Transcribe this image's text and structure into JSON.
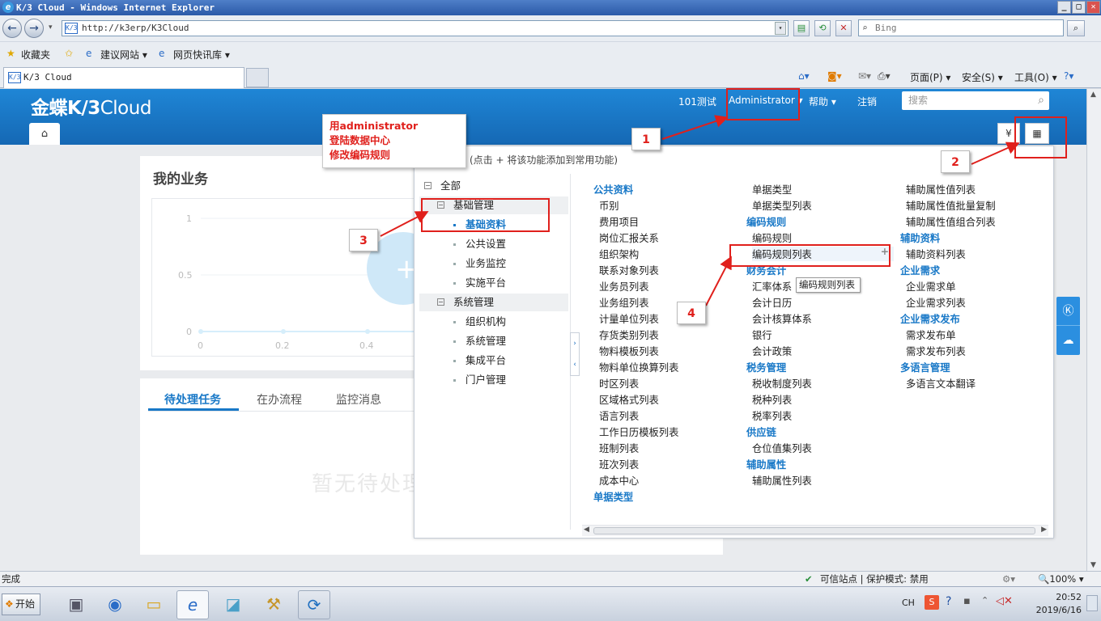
{
  "window": {
    "title": "K/3 Cloud - Windows Internet Explorer",
    "buttons": [
      "_",
      "□",
      "✕"
    ]
  },
  "browser": {
    "url": "http://k3erp/K3Cloud",
    "search_placeholder": "Bing",
    "favorites_label": "收藏夹",
    "fav_items": [
      "建议网站 ▾",
      "网页快讯库 ▾"
    ],
    "tab_title": "K/3 Cloud",
    "commands": [
      "页面(P) ▾",
      "安全(S) ▾",
      "工具(O) ▾"
    ]
  },
  "app": {
    "logo_main": "金蝶K/3",
    "logo_thin": "Cloud",
    "header_links": {
      "org": "101测试",
      "user": "Administrator ▾",
      "help": "帮助 ▾",
      "logout": "注销"
    },
    "search_placeholder": "搜索"
  },
  "dashboard": {
    "my_business": "我的业务",
    "chart_y_ticks": [
      "1",
      "0.5",
      "0"
    ],
    "chart_x_ticks": [
      "0",
      "0.2",
      "0.4"
    ],
    "tabs": [
      "待处理任务",
      "在办流程",
      "监控消息"
    ],
    "empty_text": "暂无待处理"
  },
  "panel": {
    "hint": "(点击 + 将该功能添加到常用功能)",
    "tree": {
      "root": "全部",
      "groups": [
        {
          "label": "基础管理",
          "children": [
            "基础资料",
            "公共设置",
            "业务监控",
            "实施平台"
          ]
        },
        {
          "label": "系统管理",
          "children": [
            "组织机构",
            "系统管理",
            "集成平台",
            "门户管理"
          ]
        }
      ]
    },
    "col1": [
      {
        "t": "公共资料",
        "h": true
      },
      {
        "t": "币别"
      },
      {
        "t": "费用项目"
      },
      {
        "t": "岗位汇报关系"
      },
      {
        "t": "组织架构"
      },
      {
        "t": "联系对象列表"
      },
      {
        "t": "业务员列表"
      },
      {
        "t": "业务组列表"
      },
      {
        "t": "计量单位列表"
      },
      {
        "t": "存货类别列表"
      },
      {
        "t": "物料模板列表"
      },
      {
        "t": "物料单位换算列表"
      },
      {
        "t": "时区列表"
      },
      {
        "t": "区域格式列表"
      },
      {
        "t": "语言列表"
      },
      {
        "t": "工作日历模板列表"
      },
      {
        "t": "班制列表"
      },
      {
        "t": "班次列表"
      },
      {
        "t": "成本中心"
      },
      {
        "t": "单据类型",
        "h": true
      }
    ],
    "col2": [
      {
        "t": "单据类型"
      },
      {
        "t": "单据类型列表"
      },
      {
        "t": "编码规则",
        "h": true
      },
      {
        "t": "编码规则"
      },
      {
        "t": "编码规则列表"
      },
      {
        "t": "财务会计",
        "h": true
      },
      {
        "t": "汇率体系"
      },
      {
        "t": "会计日历"
      },
      {
        "t": "会计核算体系"
      },
      {
        "t": "银行"
      },
      {
        "t": "会计政策"
      },
      {
        "t": "税务管理",
        "h": true
      },
      {
        "t": "税收制度列表"
      },
      {
        "t": "税种列表"
      },
      {
        "t": "税率列表"
      },
      {
        "t": "供应链",
        "h": true
      },
      {
        "t": "仓位值集列表"
      },
      {
        "t": "辅助属性",
        "h": true
      },
      {
        "t": "辅助属性列表"
      }
    ],
    "col3": [
      {
        "t": "辅助属性值列表"
      },
      {
        "t": "辅助属性值批量复制"
      },
      {
        "t": "辅助属性值组合列表"
      },
      {
        "t": "辅助资料",
        "h": true
      },
      {
        "t": "辅助资料列表"
      },
      {
        "t": "企业需求",
        "h": true
      },
      {
        "t": "企业需求单"
      },
      {
        "t": "企业需求列表"
      },
      {
        "t": "企业需求发布",
        "h": true
      },
      {
        "t": "需求发布单"
      },
      {
        "t": "需求发布列表"
      },
      {
        "t": "多语言管理",
        "h": true
      },
      {
        "t": "多语言文本翻译"
      }
    ],
    "tooltip": "编码规则列表"
  },
  "annotation": {
    "callout": [
      "用administrator",
      "登陆数据中心",
      "修改编码规则"
    ],
    "numbers": [
      "1",
      "2",
      "3",
      "4"
    ]
  },
  "statusbar": {
    "left": "完成",
    "zone": "可信站点 | 保护模式: 禁用",
    "zoom": "100%"
  },
  "taskbar": {
    "start": "开始",
    "lang": "CH",
    "time": "20:52",
    "date": "2019/6/16"
  },
  "colors": {
    "brand_blue": "#1a7bd0",
    "annotation_red": "#e0201c",
    "link_blue": "#1878c7"
  }
}
